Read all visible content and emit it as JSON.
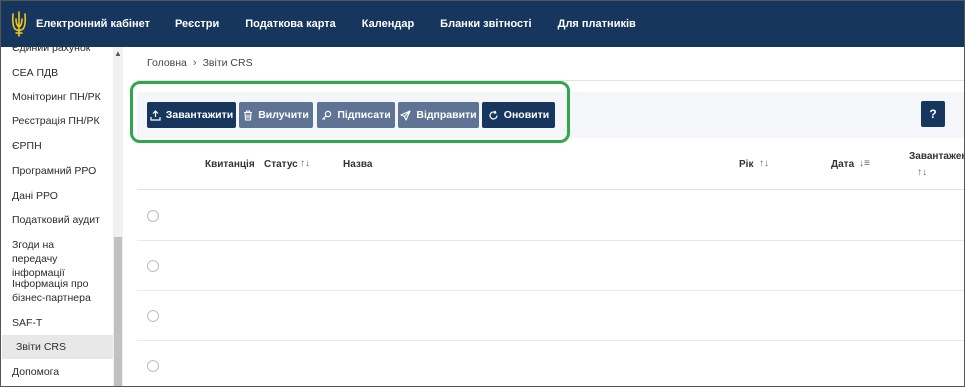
{
  "header": {
    "brand_title": "Електронний кабінет",
    "nav": [
      "Реєстри",
      "Податкова карта",
      "Календар",
      "Бланки звітності",
      "Для платників"
    ]
  },
  "sidebar": {
    "items": [
      {
        "label": "Єдиний рахунок"
      },
      {
        "label": "СЕА ПДВ"
      },
      {
        "label": "Моніторинг ПН/РК"
      },
      {
        "label": "Реєстрація ПН/РК"
      },
      {
        "label": "ЄРПН"
      },
      {
        "label": "Програмний РРО"
      },
      {
        "label": "Дані РРО"
      },
      {
        "label": "Податковий аудит"
      },
      {
        "label": "Згоди на передачу інформації"
      },
      {
        "label": "Інформація про бізнес-партнера"
      },
      {
        "label": "SAF-T"
      },
      {
        "label": "Звіти CRS",
        "active": true
      },
      {
        "label": "Допомога"
      }
    ]
  },
  "breadcrumb": {
    "home": "Головна",
    "separator": "›",
    "current": "Звіти CRS"
  },
  "toolbar": {
    "upload_label": "Завантажити",
    "delete_label": "Вилучити",
    "sign_label": "Підписати",
    "send_label": "Відправити",
    "refresh_label": "Оновити",
    "help_label": "?"
  },
  "table": {
    "columns": {
      "receipt": "Квитанція",
      "status": "Статус",
      "name": "Назва",
      "year": "Рік",
      "date": "Дата",
      "uploaded": "Завантажен"
    },
    "rows": [
      {},
      {},
      {},
      {}
    ]
  },
  "colors": {
    "navbar": "#17365d",
    "button_primary": "#17365d",
    "button_muted": "#5f7494",
    "highlight": "#2ea84a"
  }
}
